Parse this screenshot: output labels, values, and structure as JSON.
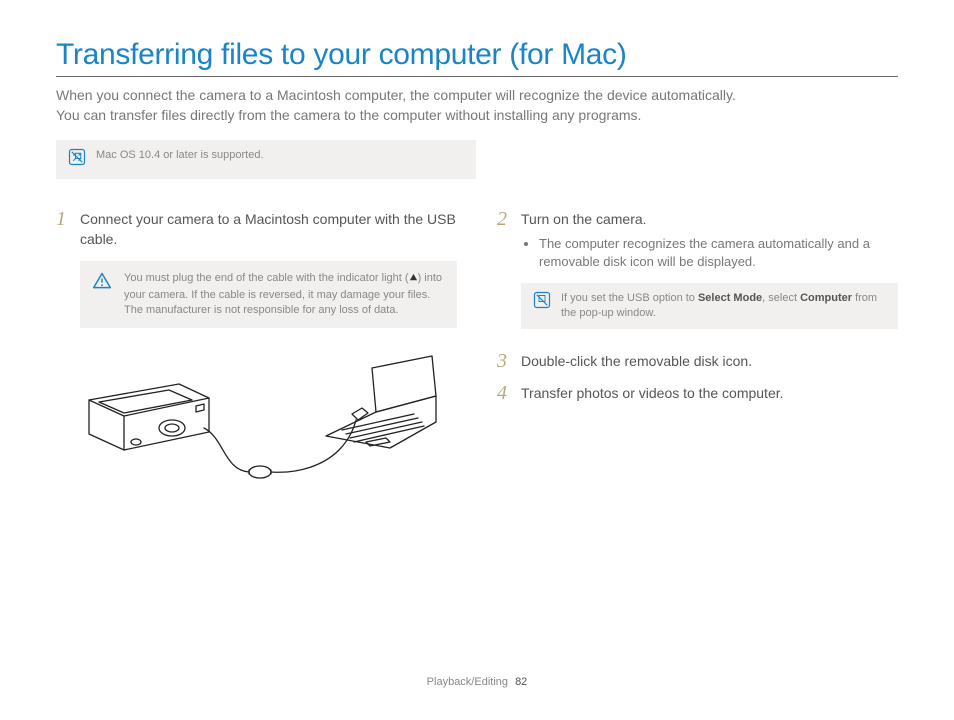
{
  "title": "Transferring files to your computer (for Mac)",
  "intro_line1": "When you connect the camera to a Macintosh computer, the computer will recognize the device automatically.",
  "intro_line2": "You can transfer files directly from the camera to the computer without installing any programs.",
  "os_tip": "Mac OS 10.4 or later is supported.",
  "steps": {
    "s1": {
      "num": "1",
      "text": "Connect your camera to a Macintosh computer with the USB cable.",
      "warn_pre": "You must plug the end of the cable with the indicator light (",
      "warn_post": ") into your camera. If the cable is reversed, it may damage your files. The manufacturer is not responsible for any loss of data."
    },
    "s2": {
      "num": "2",
      "text": "Turn on the camera.",
      "bullet": "The computer recognizes the camera automatically and a removable disk icon will be displayed.",
      "tip_pre": "If you set the USB option to ",
      "tip_bold1": "Select Mode",
      "tip_mid": ", select ",
      "tip_bold2": "Computer",
      "tip_post": " from the pop-up window."
    },
    "s3": {
      "num": "3",
      "text": "Double-click the removable disk icon."
    },
    "s4": {
      "num": "4",
      "text": "Transfer photos or videos to the computer."
    }
  },
  "footer": {
    "section": "Playback/Editing",
    "page": "82"
  }
}
